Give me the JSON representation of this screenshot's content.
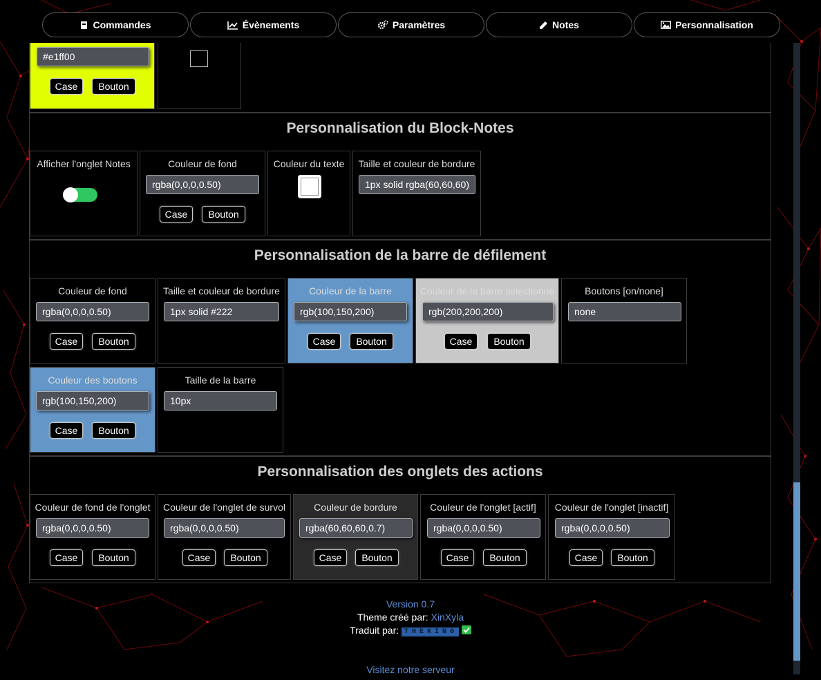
{
  "nav": {
    "tabs": [
      {
        "label": "Commandes",
        "icon": "book-icon"
      },
      {
        "label": "Évènements",
        "icon": "line-chart-icon"
      },
      {
        "label": "Paramètres",
        "icon": "gears-icon"
      },
      {
        "label": "Notes",
        "icon": "pencil-icon"
      },
      {
        "label": "Personnalisation",
        "icon": "image-icon"
      }
    ]
  },
  "top_partial": {
    "color_value": "#e1ff00",
    "case_label": "Case",
    "bouton_label": "Bouton",
    "bg_color": "#e1ff00"
  },
  "sections": {
    "notes": {
      "title": "Personnalisation du Block-Notes",
      "cards": {
        "show_tab_label": "Afficher l'onglet Notes",
        "bg_label": "Couleur de fond",
        "bg_value": "rgba(0,0,0,0.50)",
        "text_color_label": "Couleur du texte",
        "border_label": "Taille et couleur de bordure",
        "border_value": "1px solid rgba(60,60,60)"
      }
    },
    "scrollbar": {
      "title": "Personnalisation de la barre de défilement",
      "cards": {
        "bg_label": "Couleur de fond",
        "bg_value": "rgba(0,0,0,0.50)",
        "border_label": "Taille et couleur de bordure",
        "border_value": "1px solid #222",
        "bar_label": "Couleur de la barre",
        "bar_value": "rgb(100,150,200)",
        "bar_sel_label": "Couleur de la barre selectionné",
        "bar_sel_value": "rgb(200,200,200)",
        "buttons_label": "Boutons [on/none]",
        "buttons_value": "none",
        "btn_color_label": "Couleur des boutons",
        "btn_color_value": "rgb(100,150,200)",
        "size_label": "Taille de la barre",
        "size_value": "10px"
      }
    },
    "tabs": {
      "title": "Personnalisation des onglets des actions",
      "cards": {
        "bg_label": "Couleur de fond de l'onglet",
        "bg_value": "rgba(0,0,0,0.50)",
        "hover_label": "Couleur de l'onglet de survol",
        "hover_value": "rgba(0,0,0,0.50)",
        "border_label": "Couleur de bordure",
        "border_value": "rgba(60,60,60,0.7)",
        "active_label": "Couleur de l'onglet [actif]",
        "active_value": "rgba(0,0,0,0.50)",
        "inactive_label": "Couleur de l'onglet [inactif]",
        "inactive_value": "rgba(0,0,0,0.50)"
      }
    }
  },
  "buttons": {
    "case": "Case",
    "bouton": "Bouton"
  },
  "footer": {
    "version": "Version 0.7",
    "created_prefix": "Theme créé par: ",
    "author": "XinXyla",
    "translated_prefix": "Traduit par: ",
    "translator": "THEKING",
    "server_link": "Visitez notre serveur"
  },
  "colors": {
    "accent_blue": "#6496c8",
    "toggle_green": "#2ec760",
    "selected_gray": "#c8c8c8",
    "yellow": "#e1ff00"
  }
}
